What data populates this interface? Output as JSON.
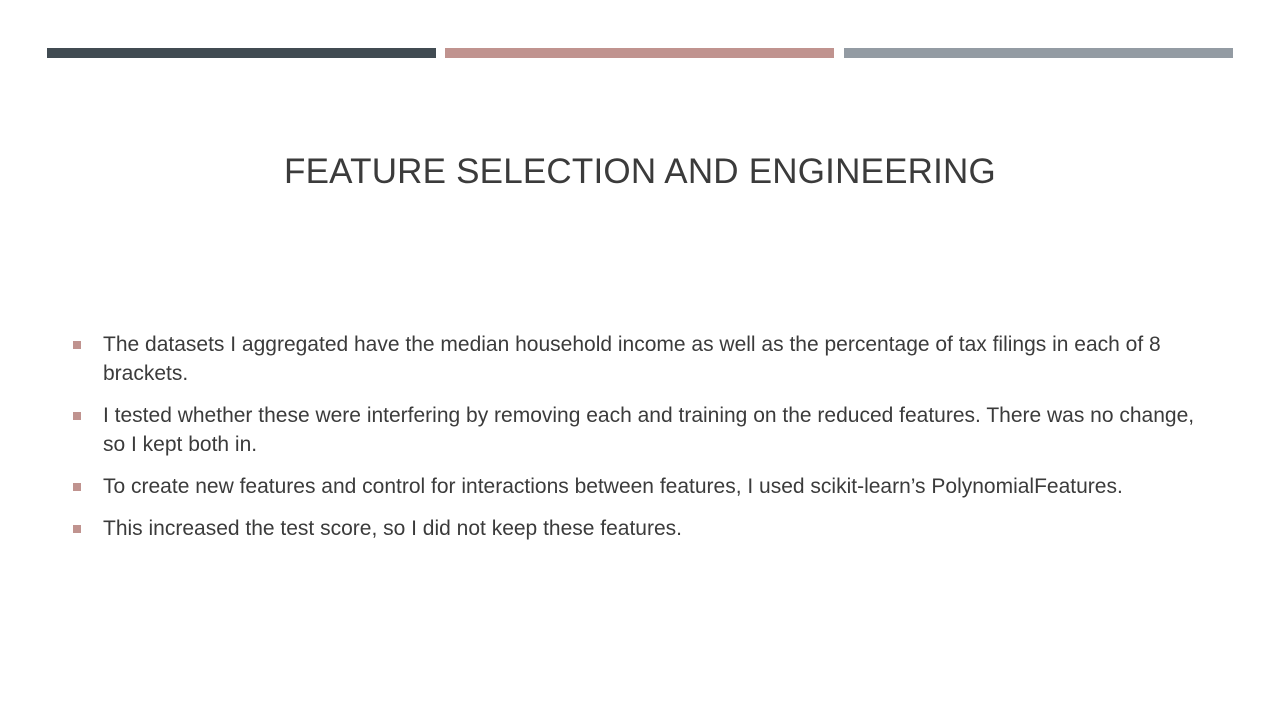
{
  "colors": {
    "bar_1": "#414b52",
    "bar_2": "#c0938f",
    "bar_3": "#939ba3",
    "bullet_marker": "#c0938f"
  },
  "slide": {
    "title": "FEATURE SELECTION AND ENGINEERING",
    "bullets": [
      "The datasets I aggregated have the median household income as well as the percentage of tax filings in each of 8 brackets.",
      "I tested whether these were interfering by removing each and training on the reduced features. There was no change, so I kept both in.",
      "To create new features and control for interactions between features, I used scikit-learn’s PolynomialFeatures.",
      "This increased the test score, so I did not keep these features."
    ]
  }
}
